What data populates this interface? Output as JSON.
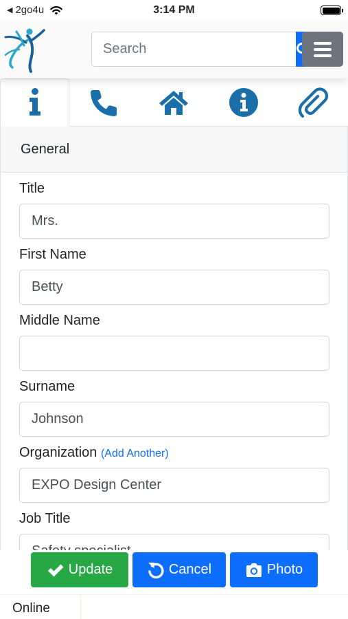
{
  "status_bar": {
    "carrier": "2go4u",
    "time": "3:14 PM"
  },
  "header": {
    "search": {
      "placeholder": "Search"
    }
  },
  "tabs": [
    {
      "icon": "info-i-icon",
      "active": true
    },
    {
      "icon": "phone-icon",
      "active": false
    },
    {
      "icon": "home-icon",
      "active": false
    },
    {
      "icon": "info-circle-icon",
      "active": false
    },
    {
      "icon": "paperclip-icon",
      "active": false
    }
  ],
  "form": {
    "section_title": "General",
    "title_label": "Title",
    "title_value": "Mrs.",
    "first_name_label": "First Name",
    "first_name_value": "Betty",
    "middle_name_label": "Middle Name",
    "middle_name_value": "",
    "surname_label": "Surname",
    "surname_value": "Johnson",
    "organization_label": "Organization",
    "organization_add_link": "(Add Another)",
    "organization_value": "EXPO Design Center",
    "job_title_label": "Job Title",
    "job_title_value": "Safety specialist"
  },
  "actions": {
    "update_label": "Update",
    "cancel_label": "Cancel",
    "photo_label": "Photo"
  },
  "footer": {
    "status": "Online"
  },
  "colors": {
    "primary": "#0d6efd",
    "success": "#28a745",
    "secondary": "#6c757d",
    "tab_icon": "#1a6fa8"
  }
}
